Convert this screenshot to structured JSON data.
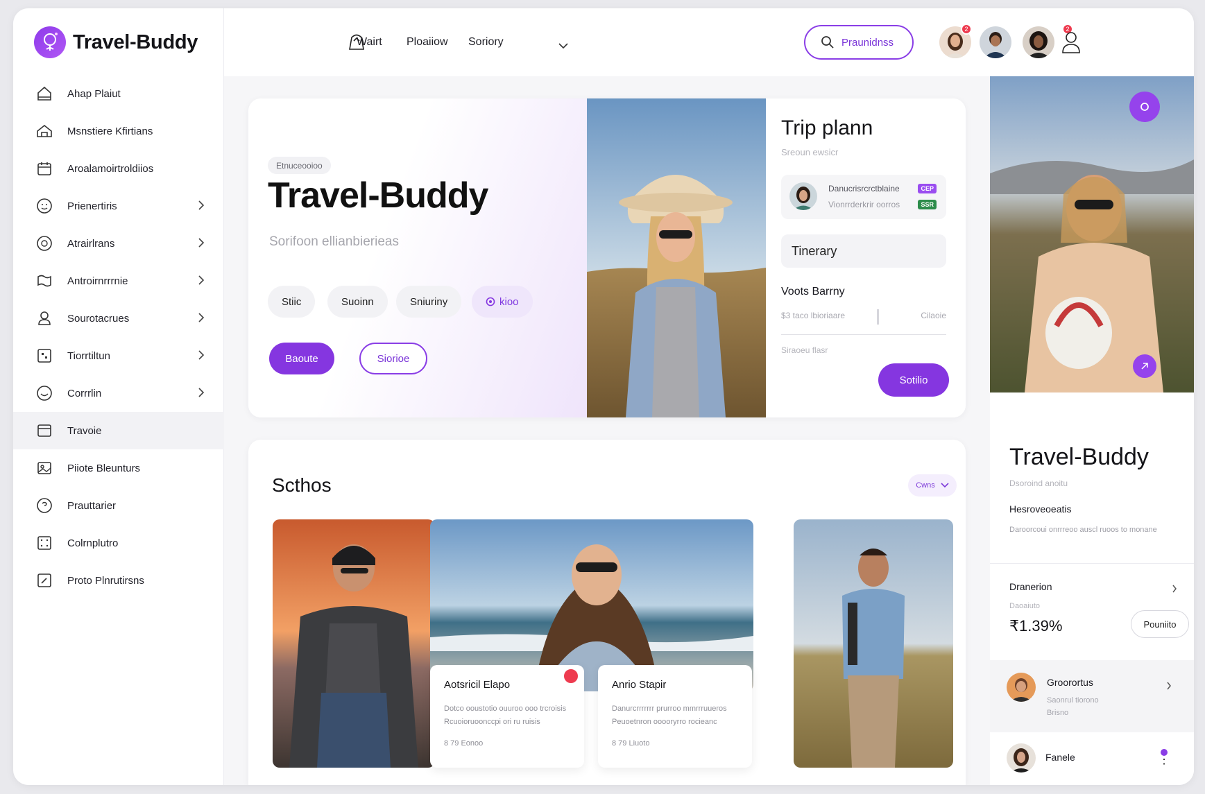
{
  "brand": {
    "name": "Travel-Buddy"
  },
  "sidebar": {
    "items": [
      {
        "label": "Ahap Plaiut",
        "icon": "home-icon",
        "chevron": false,
        "active": false
      },
      {
        "label": "Msnstiere Kfirtians",
        "icon": "house-icon",
        "chevron": false,
        "active": false
      },
      {
        "label": "Aroalamoirtroldiios",
        "icon": "calendar-icon",
        "chevron": false,
        "active": false
      },
      {
        "label": "Prienertiris",
        "icon": "smile-icon",
        "chevron": true,
        "active": false
      },
      {
        "label": "Atrairlrans",
        "icon": "compass-icon",
        "chevron": true,
        "active": false
      },
      {
        "label": "Antroirnrrrnie",
        "icon": "map-icon",
        "chevron": true,
        "active": false
      },
      {
        "label": "Sourotacrues",
        "icon": "user-icon",
        "chevron": true,
        "active": false
      },
      {
        "label": "Tiorrtiltun",
        "icon": "grid-icon",
        "chevron": true,
        "active": false
      },
      {
        "label": "Corrrlin",
        "icon": "emoji-icon",
        "chevron": true,
        "active": false
      },
      {
        "label": "Travoie",
        "icon": "window-icon",
        "chevron": false,
        "active": true
      },
      {
        "label": "Piiote Bleunturs",
        "icon": "photo-icon",
        "chevron": false,
        "active": false
      },
      {
        "label": "Prauttarier",
        "icon": "badge-icon",
        "chevron": false,
        "active": false
      },
      {
        "label": "Colrnplutro",
        "icon": "dots-grid-icon",
        "chevron": false,
        "active": false
      },
      {
        "label": "Proto Plnrutirsns",
        "icon": "edit-icon",
        "chevron": false,
        "active": false
      }
    ]
  },
  "topbar": {
    "links": [
      "Wairt",
      "Ploaiiow",
      "Soriory"
    ],
    "search_label": "Praunidnss",
    "notifications": [
      "2",
      "",
      "",
      "2"
    ]
  },
  "hero": {
    "badge": "Etnuceooioo",
    "title": "Travel-Buddy",
    "subtitle": "Sorifoon ellianbierieas",
    "chips": [
      "Stiic",
      "Suoinn",
      "Sniuriny",
      "kioo"
    ],
    "primary_btn": "Baoute",
    "outline_btn": "Siorioe"
  },
  "trip": {
    "title": "Trip plann",
    "subtitle": "Sreoun ewsicr",
    "card_line1": "Danucrisrcrctblaine",
    "card_line2": "Vionrrderkrir oorros",
    "tag1": "CEP",
    "tag2": "SSR",
    "itinerary": "Tinerary",
    "budget_label": "Voots Barrny",
    "slider_left": "$3 taco lbioriaare",
    "slider_right": "Cilaoie",
    "note": "Siraoeu flasr",
    "btn": "Sotilio",
    "colors": {
      "accent": "#8536e0",
      "tag1": "#9a4df0",
      "tag2": "#2c8c4a"
    }
  },
  "stories": {
    "title": "Scthos",
    "sort_label": "Cwns",
    "cards": [
      {
        "title": "Aotsricil Elapo",
        "desc": "Dotco ooustotio ouuroo ooo trcroisis Rcuoioruoonccpi ori ru ruisis",
        "meta": "8 79 Eonoo"
      },
      {
        "title": "Anrio Stapir",
        "desc": "Danurcrrrrrrr prurroo mmrrruueros Peuoetnron ooooryrro rocieanc",
        "meta": "8 79 Liuoto"
      }
    ]
  },
  "right_panel": {
    "title": "Travel-Buddy",
    "subtitle": "Dsoroind anoitu",
    "heading": "Hesroveoeatis",
    "desc": "Daroorcoui onrrreoo auscl ruoos to monane",
    "dest_label": "Dranerion",
    "dest_sub": "Daoaiuto",
    "value": "₹1.39%",
    "btn": "Pouniito",
    "row1": {
      "name": "Groorortus",
      "sub1": "Saonrul tiorono",
      "sub2": "Brisno"
    },
    "row2": {
      "name": "Fanele"
    }
  }
}
